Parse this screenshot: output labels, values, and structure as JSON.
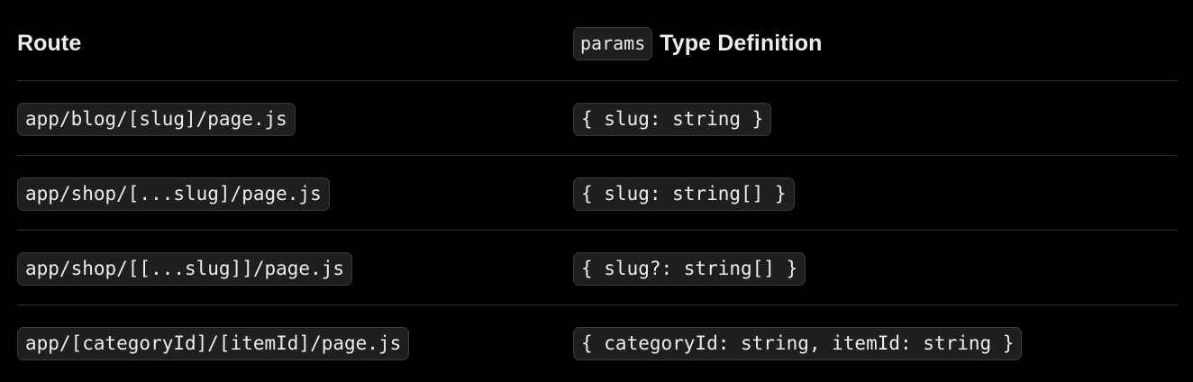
{
  "header": {
    "route_label": "Route",
    "params_code": "params",
    "type_definition_label": "Type Definition"
  },
  "rows": [
    {
      "route": "app/blog/[slug]/page.js",
      "params_type": "{ slug: string }"
    },
    {
      "route": "app/shop/[...slug]/page.js",
      "params_type": "{ slug: string[] }"
    },
    {
      "route": "app/shop/[[...slug]]/page.js",
      "params_type": "{ slug?: string[] }"
    },
    {
      "route": "app/[categoryId]/[itemId]/page.js",
      "params_type": "{ categoryId: string, itemId: string }"
    }
  ]
}
